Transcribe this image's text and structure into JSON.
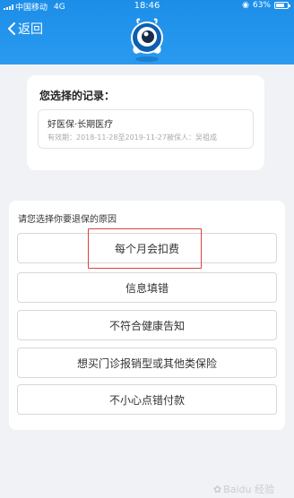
{
  "status": {
    "carrier": "中国移动",
    "network": "4G",
    "time": "18:46",
    "battery": "63%"
  },
  "nav": {
    "back_label": "返回"
  },
  "record": {
    "heading": "您选择的记录：",
    "name": "好医保·长期医疗",
    "details": "有效期：2018-11-28至2019-11-27被保人：吴祖成"
  },
  "reason": {
    "prompt": "请您选择你要退保的原因",
    "options": [
      "每个月会扣费",
      "信息填错",
      "不符合健康告知",
      "想买门诊报销型或其他类保险",
      "不小心点错付款"
    ]
  },
  "watermark": "Baidu 经验",
  "colors": {
    "header": "#1c8ee8",
    "highlight": "#d9423f",
    "background": "#f0f2f5"
  }
}
